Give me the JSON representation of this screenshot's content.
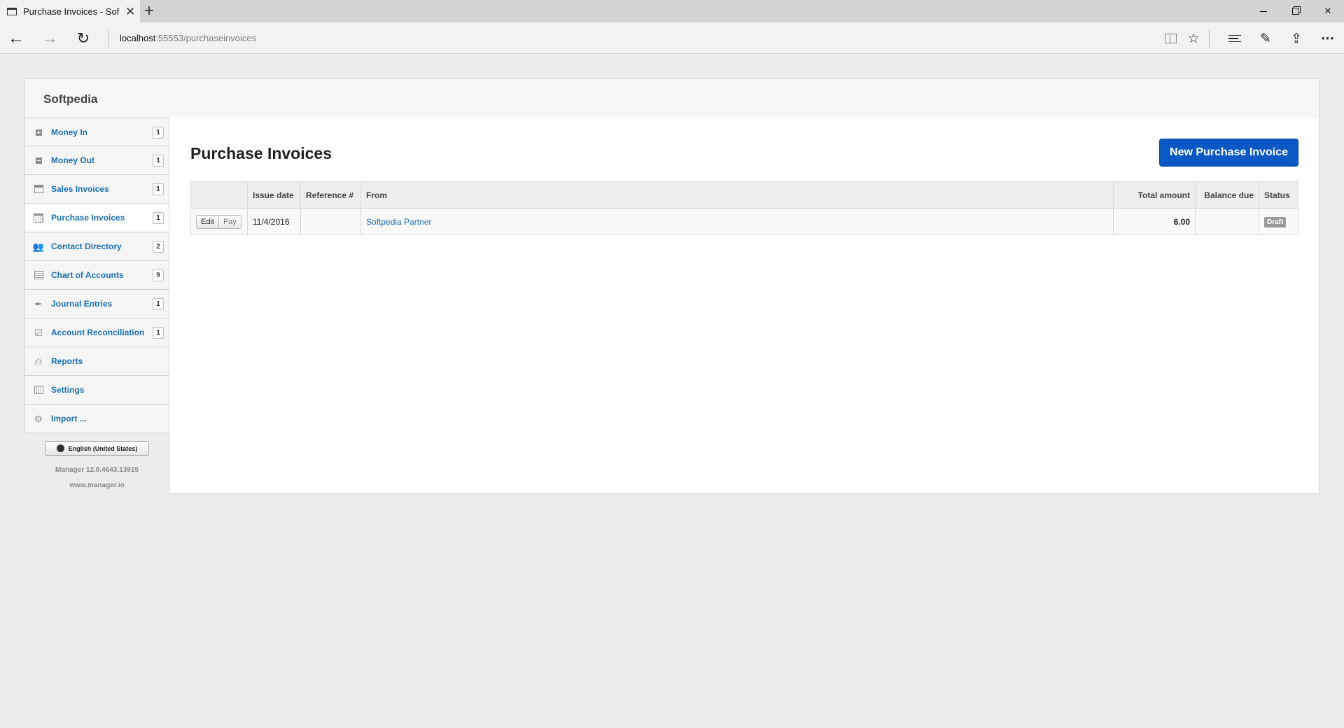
{
  "browser": {
    "tab_title": "Purchase Invoices - Soft",
    "url_host": "localhost",
    "url_rest": ":55553/purchaseinvoices",
    "new_tab": "+",
    "tab_close": "✕"
  },
  "app": {
    "company": "Softpedia",
    "sidebar": [
      {
        "label": "Money In",
        "count": "1",
        "icon": "plus-square-icon"
      },
      {
        "label": "Money Out",
        "count": "1",
        "icon": "minus-square-icon"
      },
      {
        "label": "Sales Invoices",
        "count": "1",
        "icon": "cash-register-icon"
      },
      {
        "label": "Purchase Invoices",
        "count": "1",
        "icon": "calendar-icon"
      },
      {
        "label": "Contact Directory",
        "count": "2",
        "icon": "people-icon"
      },
      {
        "label": "Chart of Accounts",
        "count": "9",
        "icon": "ledger-icon"
      },
      {
        "label": "Journal Entries",
        "count": "1",
        "icon": "pen-icon"
      },
      {
        "label": "Account Reconciliation",
        "count": "1",
        "icon": "checkbox-icon"
      },
      {
        "label": "Reports",
        "count": "",
        "icon": "printer-icon"
      },
      {
        "label": "Settings",
        "count": "",
        "icon": "settings-icon"
      },
      {
        "label": "Import ...",
        "count": "",
        "icon": "import-icon"
      }
    ],
    "language": "English (United States)",
    "version": "Manager 12.8.4643.13915",
    "website": "www.manager.io"
  },
  "main": {
    "title": "Purchase Invoices",
    "new_button": "New Purchase Invoice",
    "columns": [
      "",
      "Issue date",
      "Reference #",
      "From",
      "Total amount",
      "Balance due",
      "Status"
    ],
    "rows": [
      {
        "edit": "Edit",
        "pay": "Pay",
        "issue_date": "11/4/2016",
        "reference": "",
        "from": "Softpedia Partner",
        "total": "6.00",
        "balance": "",
        "status": "Draft"
      }
    ]
  },
  "colors": {
    "accent": "#0a58c4",
    "link": "#1a6fb6",
    "status_draft": "#999999"
  }
}
